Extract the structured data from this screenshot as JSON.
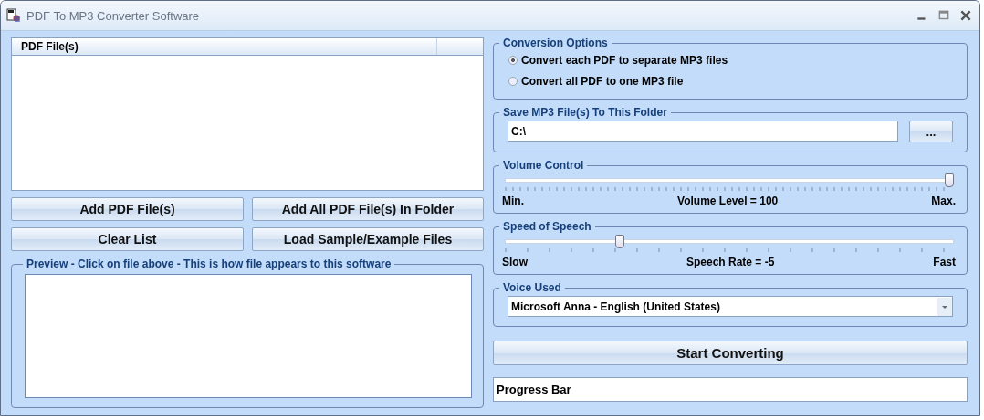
{
  "window": {
    "title": "PDF To MP3 Converter Software"
  },
  "file_list": {
    "columns": [
      "PDF File(s)"
    ]
  },
  "left_buttons": [
    "Add PDF File(s)",
    "Add All PDF File(s) In Folder",
    "Clear List",
    "Load Sample/Example Files"
  ],
  "preview": {
    "title": "Preview - Click on file above - This is how file appears to this software"
  },
  "conversion_options": {
    "title": "Conversion Options",
    "options": [
      {
        "label": "Convert each PDF to separate MP3 files",
        "selected": true
      },
      {
        "label": "Convert all PDF to one MP3 file",
        "selected": false
      }
    ]
  },
  "save_folder": {
    "title": "Save MP3 File(s) To This Folder",
    "value": "C:\\",
    "browse": "..."
  },
  "volume": {
    "title": "Volume Control",
    "level": 1,
    "min": "Min.",
    "reading": "Volume Level = 100",
    "max": "Max."
  },
  "speed": {
    "title": "Speed of Speech",
    "level": 0.25,
    "min": "Slow",
    "reading": "Speech Rate = -5",
    "max": "Fast"
  },
  "voice": {
    "title": "Voice Used",
    "value": "Microsoft Anna - English (United States)"
  },
  "start_button": "Start Converting",
  "progress": {
    "label": "Progress Bar"
  }
}
